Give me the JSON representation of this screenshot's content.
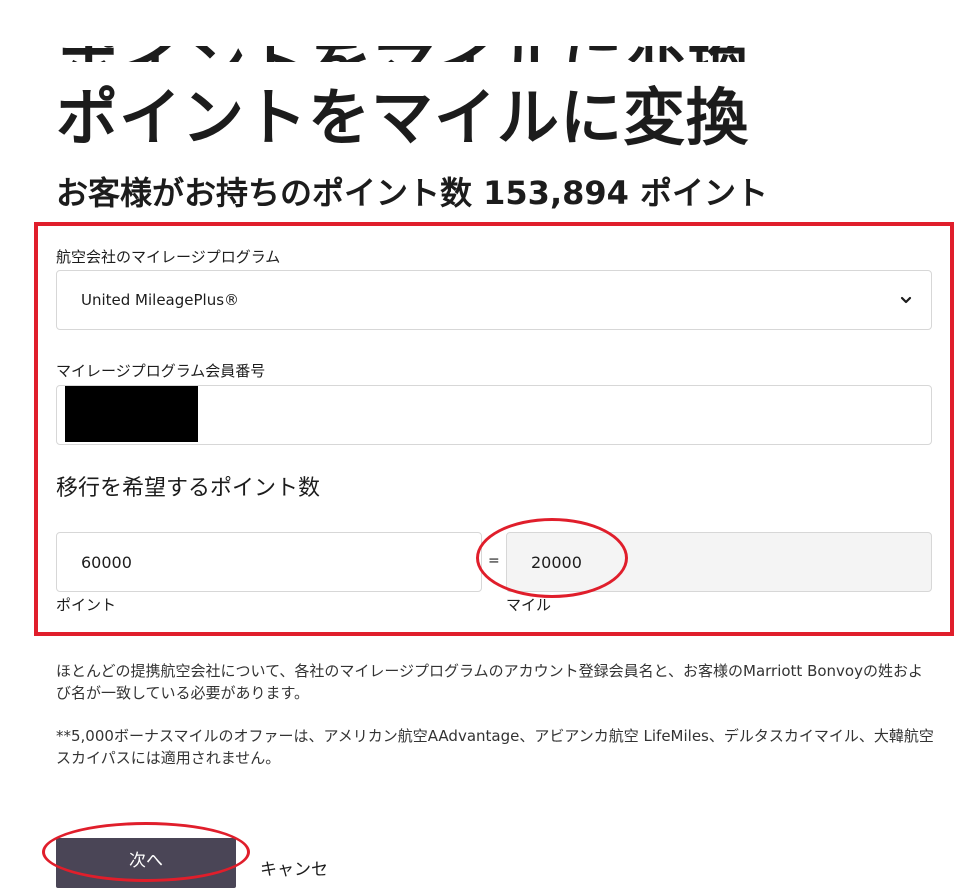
{
  "header": {
    "ghost_title": "ポイントをマイルに変換",
    "title": "ポイントをマイルに変換",
    "subtitle": "お客様がお持ちのポイント数 153,894 ポイント"
  },
  "form": {
    "airline_label": "航空会社のマイレージプログラム",
    "airline_selected": "United MileagePlus®",
    "member_number_label": "マイレージプログラム会員番号",
    "member_number_value": "",
    "transfer_heading": "移行を希望するポイント数",
    "points_value": "60000",
    "equals_sign": "=",
    "miles_value": "20000",
    "points_unit": "ポイント",
    "miles_unit": "マイル"
  },
  "notes": {
    "name_match": "ほとんどの提携航空会社について、各社のマイレージプログラムのアカウント登録会員名と、お客様のMarriott Bonvoyの姓および名が一致している必要があります。",
    "bonus_exclusion": "**5,000ボーナスマイルのオファーは、アメリカン航空AAdvantage、アビアンカ航空 LifeMiles、デルタスカイマイル、大韓航空スカイパスには適用されません。"
  },
  "actions": {
    "next_label": "次へ",
    "cancel_label": "キャンセ"
  },
  "colors": {
    "annotation_red": "#e01e2b",
    "button_bg": "#4a4556"
  }
}
